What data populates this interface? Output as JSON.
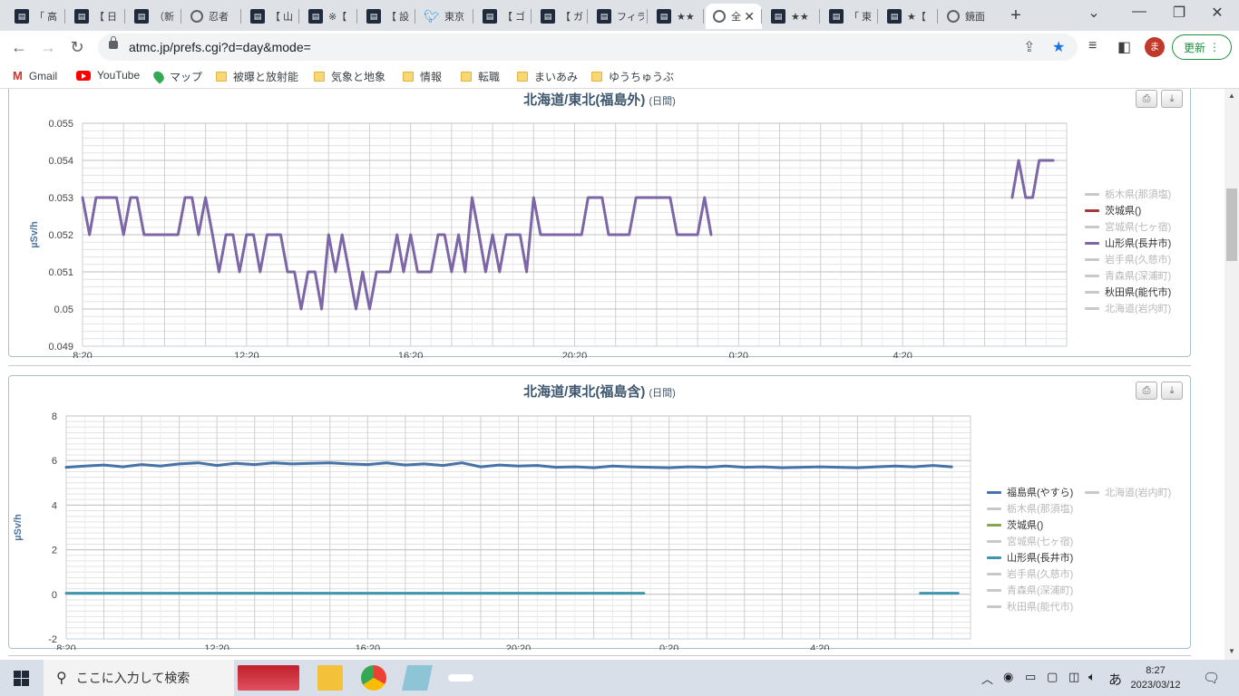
{
  "browser": {
    "tabs": [
      {
        "label": "「 高",
        "icon": "site-icon"
      },
      {
        "label": "【 日",
        "icon": "site-icon"
      },
      {
        "label": "（新",
        "icon": "site-icon"
      },
      {
        "label": "忍者",
        "icon": "globe-icon"
      },
      {
        "label": "【 山",
        "icon": "site-icon"
      },
      {
        "label": "※【",
        "icon": "site-icon"
      },
      {
        "label": "【 設",
        "icon": "site-icon"
      },
      {
        "label": "東京",
        "icon": "twitter-icon"
      },
      {
        "label": "【 ゴ",
        "icon": "site-icon"
      },
      {
        "label": "【 ガ",
        "icon": "site-icon"
      },
      {
        "label": "フィラ",
        "icon": "site-icon"
      },
      {
        "label": "★★",
        "icon": "site-icon"
      },
      {
        "label": "全",
        "icon": "globe-icon",
        "active": true
      },
      {
        "label": "★★",
        "icon": "site-icon"
      },
      {
        "label": "「 東",
        "icon": "site-icon"
      },
      {
        "label": "★【",
        "icon": "site-icon"
      },
      {
        "label": "鏡面",
        "icon": "globe-icon"
      }
    ],
    "url": "atmc.jp/prefs.cgi?d=day&mode=",
    "profile_initial": "ま",
    "update_label": "更新"
  },
  "bookmarks": [
    {
      "label": "Gmail",
      "icon": "gmail-icon"
    },
    {
      "label": "YouTube",
      "icon": "youtube-icon"
    },
    {
      "label": "マップ",
      "icon": "maps-icon"
    },
    {
      "label": "被曝と放射能",
      "icon": "folder-icon"
    },
    {
      "label": "気象と地象",
      "icon": "folder-icon"
    },
    {
      "label": "情報",
      "icon": "folder-icon"
    },
    {
      "label": "転職",
      "icon": "folder-icon"
    },
    {
      "label": "まいあみ",
      "icon": "folder-icon"
    },
    {
      "label": "ゆうちゅうぶ",
      "icon": "folder-icon"
    }
  ],
  "chart_data": [
    {
      "type": "line",
      "title": "北海道/東北(福島外)",
      "subtitle": "(日間)",
      "ylabel": "µSv/h",
      "ylim": [
        0.049,
        0.055
      ],
      "yticks": [
        "0.055",
        "0.054",
        "0.053",
        "0.052",
        "0.051",
        "0.05",
        "0.049"
      ],
      "xticks": [
        "8:20",
        "12:20",
        "16:20",
        "20:20",
        "0:20",
        "4:20"
      ],
      "legend": [
        {
          "name": "栃木県(那須塩)",
          "color": "#c8c8c8",
          "active": false
        },
        {
          "name": "茨城県()",
          "color": "#a23b3b",
          "active": true
        },
        {
          "name": "宮城県(七ヶ宿)",
          "color": "#c8c8c8",
          "active": false
        },
        {
          "name": "山形県(長井市)",
          "color": "#7d66a6",
          "active": true
        },
        {
          "name": "岩手県(久慈市)",
          "color": "#c8c8c8",
          "active": false
        },
        {
          "name": "青森県(深浦町)",
          "color": "#c8c8c8",
          "active": false
        },
        {
          "name": "秋田県(能代市)",
          "color": "#c8c8c8",
          "active": true
        },
        {
          "name": "北海道(岩内町)",
          "color": "#c8c8c8",
          "active": false
        }
      ],
      "series": [
        {
          "name": "山形県(長井市)",
          "color": "#7d66a6",
          "segments": [
            {
              "x": [
                0,
                0.17,
                0.33,
                0.5,
                0.67,
                0.83,
                1,
                1.17,
                1.33,
                1.5,
                1.67,
                1.83,
                2,
                2.17,
                2.33,
                2.5,
                2.67,
                2.83,
                3,
                3.17,
                3.33,
                3.5,
                3.67,
                3.83,
                4,
                4.17,
                4.33,
                4.5,
                4.67,
                4.83,
                5,
                5.17,
                5.33,
                5.5,
                5.67,
                5.83,
                6,
                6.17,
                6.33,
                6.5,
                6.67,
                6.83,
                7,
                7.17,
                7.33,
                7.5,
                7.67,
                7.83,
                8,
                8.17,
                8.33,
                8.5,
                8.67,
                8.83,
                9,
                9.17,
                9.33,
                9.5,
                9.67,
                9.83,
                10,
                10.17,
                10.33,
                10.5,
                10.67,
                10.83,
                11,
                11.17,
                11.33,
                11.5,
                11.67,
                11.83,
                12,
                12.17,
                12.33,
                12.5,
                12.67,
                12.83,
                13,
                13.17,
                13.33,
                13.5,
                13.67,
                13.83,
                14,
                14.17,
                14.33,
                14.5,
                14.67,
                14.83,
                15,
                15.17,
                15.33
              ],
              "y": [
                0.053,
                0.052,
                0.053,
                0.053,
                0.053,
                0.053,
                0.052,
                0.053,
                0.053,
                0.052,
                0.052,
                0.052,
                0.052,
                0.052,
                0.052,
                0.053,
                0.053,
                0.052,
                0.053,
                0.052,
                0.051,
                0.052,
                0.052,
                0.051,
                0.052,
                0.052,
                0.051,
                0.052,
                0.052,
                0.052,
                0.051,
                0.051,
                0.05,
                0.051,
                0.051,
                0.05,
                0.052,
                0.051,
                0.052,
                0.051,
                0.05,
                0.051,
                0.05,
                0.051,
                0.051,
                0.051,
                0.052,
                0.051,
                0.052,
                0.051,
                0.051,
                0.051,
                0.052,
                0.052,
                0.051,
                0.052,
                0.051,
                0.053,
                0.052,
                0.051,
                0.052,
                0.051,
                0.052,
                0.052,
                0.052,
                0.051,
                0.053,
                0.052,
                0.052,
                0.052,
                0.052,
                0.052,
                0.052,
                0.052,
                0.053,
                0.053,
                0.053,
                0.052,
                0.052,
                0.052,
                0.052,
                0.053,
                0.053,
                0.053,
                0.053,
                0.053,
                0.053,
                0.052,
                0.052,
                0.052,
                0.052,
                0.053,
                0.052,
                0.053
              ]
            },
            {
              "x": [
                22.67,
                22.83,
                23,
                23.17,
                23.33,
                23.5,
                23.67
              ],
              "y": [
                0.053,
                0.054,
                0.053,
                0.053,
                0.054,
                0.054,
                0.054
              ]
            }
          ]
        }
      ]
    },
    {
      "type": "line",
      "title": "北海道/東北(福島含)",
      "subtitle": "(日間)",
      "ylabel": "µSv/h",
      "ylim": [
        -2,
        8
      ],
      "yticks": [
        "8",
        "6",
        "4",
        "2",
        "0",
        "-2"
      ],
      "xticks": [
        "8:20",
        "12:20",
        "16:20",
        "20:20",
        "0:20",
        "4:20"
      ],
      "legend": [
        {
          "name": "福島県(やすら)",
          "color": "#4572a7",
          "active": true
        },
        {
          "name": "北海道(岩内町)",
          "color": "#c8c8c8",
          "active": false
        },
        {
          "name": "栃木県(那須塩)",
          "color": "#c8c8c8",
          "active": false
        },
        {
          "name": "茨城県()",
          "color": "#89a54e",
          "active": true
        },
        {
          "name": "宮城県(七ヶ宿)",
          "color": "#c8c8c8",
          "active": false
        },
        {
          "name": "山形県(長井市)",
          "color": "#3d96ae",
          "active": true
        },
        {
          "name": "岩手県(久慈市)",
          "color": "#c8c8c8",
          "active": false
        },
        {
          "name": "青森県(深浦町)",
          "color": "#c8c8c8",
          "active": false
        },
        {
          "name": "秋田県(能代市)",
          "color": "#c8c8c8",
          "active": false
        }
      ],
      "series": [
        {
          "name": "福島県(やすら)",
          "color": "#4572a7",
          "segments": [
            {
              "x": [
                0,
                0.5,
                1,
                1.5,
                2,
                2.5,
                3,
                3.5,
                4,
                4.5,
                5,
                5.5,
                6,
                6.5,
                7,
                7.5,
                8,
                8.5,
                9,
                9.5,
                10,
                10.5,
                11,
                11.5,
                12,
                12.5,
                13,
                13.5,
                14,
                14.5,
                15,
                15.5,
                16,
                16.5,
                17,
                17.5,
                18,
                18.5,
                19,
                19.5,
                20,
                20.5,
                21,
                21.5,
                22,
                22.5,
                23,
                23.5
              ],
              "y": [
                5.7,
                5.75,
                5.8,
                5.72,
                5.82,
                5.75,
                5.85,
                5.9,
                5.78,
                5.88,
                5.82,
                5.9,
                5.85,
                5.88,
                5.9,
                5.85,
                5.82,
                5.9,
                5.8,
                5.85,
                5.78,
                5.9,
                5.72,
                5.8,
                5.75,
                5.78,
                5.7,
                5.72,
                5.68,
                5.75,
                5.72,
                5.7,
                5.68,
                5.72,
                5.7,
                5.75,
                5.7,
                5.72,
                5.68,
                5.7,
                5.72,
                5.7,
                5.68,
                5.72,
                5.75,
                5.72,
                5.78,
                5.72
              ]
            }
          ]
        },
        {
          "name": "山形県(長井市)",
          "color": "#3d96ae",
          "segments": [
            {
              "x": [
                0,
                15.33
              ],
              "y": [
                0.05,
                0.05
              ]
            },
            {
              "x": [
                22.67,
                23.67
              ],
              "y": [
                0.05,
                0.05
              ]
            }
          ]
        }
      ]
    }
  ],
  "taskbar": {
    "search_placeholder": "ここに入力して検索",
    "ime": "あ",
    "time": "8:27",
    "date": "2023/03/12"
  }
}
